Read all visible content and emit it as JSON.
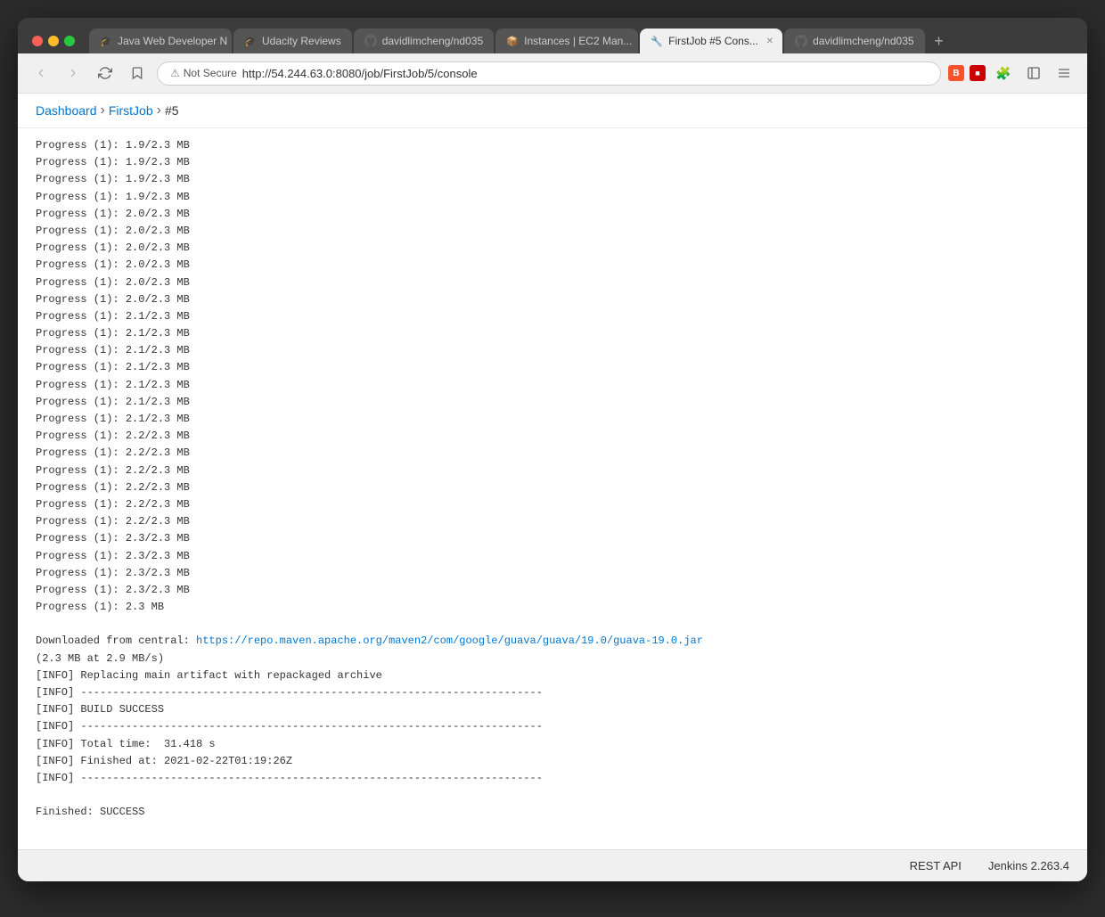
{
  "browser": {
    "traffic_lights": [
      "red",
      "yellow",
      "green"
    ],
    "tabs": [
      {
        "id": "tab-1",
        "label": "Java Web Developer N",
        "icon": "🎓",
        "active": false
      },
      {
        "id": "tab-2",
        "label": "Udacity Reviews",
        "icon": "🎓",
        "active": false
      },
      {
        "id": "tab-3",
        "label": "davidlimcheng/nd035",
        "icon": "🐙",
        "active": false
      },
      {
        "id": "tab-4",
        "label": "Instances | EC2 Man...",
        "icon": "📦",
        "active": false
      },
      {
        "id": "tab-5",
        "label": "FirstJob #5 Cons...",
        "icon": "🔧",
        "active": true
      },
      {
        "id": "tab-6",
        "label": "davidlimcheng/nd035",
        "icon": "🐙",
        "active": false
      }
    ],
    "add_tab_label": "+",
    "nav": {
      "back_disabled": true,
      "forward_disabled": true,
      "not_secure_label": "Not Secure",
      "url": "http://54.244.63.0:8080/job/FirstJob/5/console",
      "url_domain": "54.244.63.0",
      "url_port": ":8080",
      "url_path": "/job/FirstJob/5/console"
    }
  },
  "page": {
    "breadcrumb": [
      {
        "label": "Dashboard",
        "link": true
      },
      {
        "label": "FirstJob",
        "link": true
      },
      {
        "label": "#5",
        "link": false
      }
    ],
    "console_lines": [
      "Progress (1): 1.9/2.3 MB",
      "Progress (1): 1.9/2.3 MB",
      "Progress (1): 1.9/2.3 MB",
      "Progress (1): 1.9/2.3 MB",
      "Progress (1): 2.0/2.3 MB",
      "Progress (1): 2.0/2.3 MB",
      "Progress (1): 2.0/2.3 MB",
      "Progress (1): 2.0/2.3 MB",
      "Progress (1): 2.0/2.3 MB",
      "Progress (1): 2.0/2.3 MB",
      "Progress (1): 2.1/2.3 MB",
      "Progress (1): 2.1/2.3 MB",
      "Progress (1): 2.1/2.3 MB",
      "Progress (1): 2.1/2.3 MB",
      "Progress (1): 2.1/2.3 MB",
      "Progress (1): 2.1/2.3 MB",
      "Progress (1): 2.1/2.3 MB",
      "Progress (1): 2.2/2.3 MB",
      "Progress (1): 2.2/2.3 MB",
      "Progress (1): 2.2/2.3 MB",
      "Progress (1): 2.2/2.3 MB",
      "Progress (1): 2.2/2.3 MB",
      "Progress (1): 2.2/2.3 MB",
      "Progress (1): 2.3/2.3 MB",
      "Progress (1): 2.3/2.3 MB",
      "Progress (1): 2.3/2.3 MB",
      "Progress (1): 2.3/2.3 MB",
      "Progress (1): 2.3 MB"
    ],
    "downloaded_prefix": "Downloaded from central: ",
    "downloaded_url": "https://repo.maven.apache.org/maven2/com/google/guava/guava/19.0/guava-19.0.jar",
    "downloaded_size": "(2.3 MB at 2.9 MB/s)",
    "build_info_lines": [
      "[INFO] Replacing main artifact with repackaged archive",
      "[INFO] ------------------------------------------------------------------------",
      "[INFO] BUILD SUCCESS",
      "[INFO] ------------------------------------------------------------------------",
      "[INFO] Total time:  31.418 s",
      "[INFO] Finished at: 2021-02-22T01:19:26Z",
      "[INFO] ------------------------------------------------------------------------"
    ],
    "finished_line": "Finished: SUCCESS",
    "footer": {
      "rest_api_label": "REST API",
      "version_label": "Jenkins 2.263.4"
    }
  }
}
